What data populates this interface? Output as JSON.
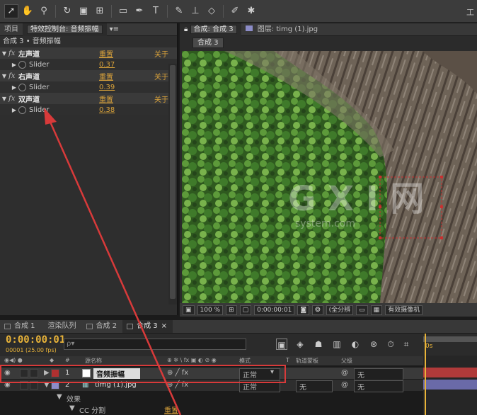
{
  "toolbar": {
    "workspace_label": "工"
  },
  "left_panel": {
    "tabs": [
      {
        "label": "项目"
      },
      {
        "label": "特效控制台: 音频振幅"
      }
    ],
    "breadcrumb": "合成 3 • 音频振幅",
    "effects": [
      {
        "name": "左声道",
        "reset": "重置",
        "about": "关于",
        "slider_label": "Slider",
        "slider_value": "0.37"
      },
      {
        "name": "右声道",
        "reset": "重置",
        "about": "关于",
        "slider_label": "Slider",
        "slider_value": "0.39"
      },
      {
        "name": "双声道",
        "reset": "重置",
        "about": "关于",
        "slider_label": "Slider",
        "slider_value": "0.38"
      }
    ]
  },
  "right_panel": {
    "tabs": [
      {
        "label": "合成: 合成 3"
      },
      {
        "label": "图层: timg (1).jpg"
      }
    ],
    "sub_tab": "合成 3",
    "watermark": {
      "main": "G X I 网",
      "sub": "system.com"
    },
    "viewer_bar": {
      "zoom": "100 %",
      "timecode": "0:00:00:01",
      "resolution": "(全分辨",
      "camera": "有效摄像机"
    }
  },
  "timeline": {
    "tabs": [
      {
        "label": "合成 1"
      },
      {
        "label": "渲染队列"
      },
      {
        "label": "合成 2"
      },
      {
        "label": "合成 3"
      }
    ],
    "time": "0:00:00:01",
    "fps": "00001 (25.00 fps)",
    "search_placeholder": "ρ▾",
    "headers": {
      "num": "#",
      "source": "源名称",
      "mode": "模式",
      "t": "T",
      "trkmat": "轨道蒙板",
      "parent": "父级",
      "ruler": "0s"
    },
    "layers": [
      {
        "num": "1",
        "name": "音频振幅",
        "mode": "正常",
        "trkmat": "",
        "parent": "无",
        "color": "#b03030"
      },
      {
        "num": "2",
        "name": "timg (1).jpg",
        "mode": "正常",
        "trkmat": "无",
        "parent": "无",
        "color": "#8c8cc8"
      }
    ],
    "sub_rows": [
      {
        "label": "效果"
      },
      {
        "label": "CC 分割",
        "reset": "重置"
      }
    ]
  },
  "colors": {
    "accent": "#e8b339",
    "annotation": "#d83a3a",
    "layer1": "#b03030",
    "layer2": "#8c8cc8"
  }
}
